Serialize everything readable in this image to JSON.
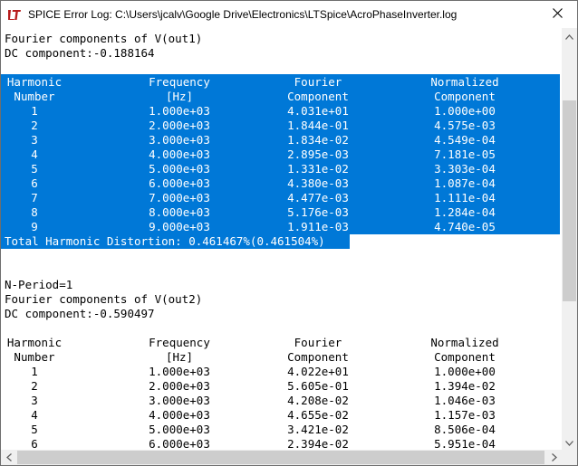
{
  "window": {
    "title": "SPICE Error Log: C:\\Users\\jcalv\\Google Drive\\Electronics\\LTSpice\\AcroPhaseInverter.log",
    "app_icon": "ltspice-logo-icon",
    "close_icon": "close-icon"
  },
  "log": {
    "section1": {
      "heading": "Fourier components of V(out1)",
      "dc": "DC component:-0.188164",
      "header1": [
        "Harmonic",
        "Frequency",
        "Fourier",
        "Normalized"
      ],
      "header2": [
        "Number",
        "[Hz]",
        "Component",
        "Component"
      ],
      "rows": [
        [
          "1",
          "1.000e+03",
          "4.031e+01",
          "1.000e+00"
        ],
        [
          "2",
          "2.000e+03",
          "1.844e-01",
          "4.575e-03"
        ],
        [
          "3",
          "3.000e+03",
          "1.834e-02",
          "4.549e-04"
        ],
        [
          "4",
          "4.000e+03",
          "2.895e-03",
          "7.181e-05"
        ],
        [
          "5",
          "5.000e+03",
          "1.331e-02",
          "3.303e-04"
        ],
        [
          "6",
          "6.000e+03",
          "4.380e-03",
          "1.087e-04"
        ],
        [
          "7",
          "7.000e+03",
          "4.477e-03",
          "1.111e-04"
        ],
        [
          "8",
          "8.000e+03",
          "5.176e-03",
          "1.284e-04"
        ],
        [
          "9",
          "9.000e+03",
          "1.911e-03",
          "4.740e-05"
        ]
      ],
      "thd": "Total Harmonic Distortion: 0.461467%(0.461504%)"
    },
    "section2": {
      "period": "N-Period=1",
      "heading": "Fourier components of V(out2)",
      "dc": "DC component:-0.590497",
      "header1": [
        "Harmonic",
        "Frequency",
        "Fourier",
        "Normalized"
      ],
      "header2": [
        "Number",
        "[Hz]",
        "Component",
        "Component"
      ],
      "rows": [
        [
          "1",
          "1.000e+03",
          "4.022e+01",
          "1.000e+00"
        ],
        [
          "2",
          "2.000e+03",
          "5.605e-01",
          "1.394e-02"
        ],
        [
          "3",
          "3.000e+03",
          "4.208e-02",
          "1.046e-03"
        ],
        [
          "4",
          "4.000e+03",
          "4.655e-02",
          "1.157e-03"
        ],
        [
          "5",
          "5.000e+03",
          "3.421e-02",
          "8.506e-04"
        ],
        [
          "6",
          "6.000e+03",
          "2.394e-02",
          "5.951e-04"
        ]
      ]
    }
  },
  "colors": {
    "selection": "#0078d7",
    "selection_text": "#ffffff",
    "scrollbar": "#f0f0f0",
    "thumb": "#cdcdcd"
  }
}
